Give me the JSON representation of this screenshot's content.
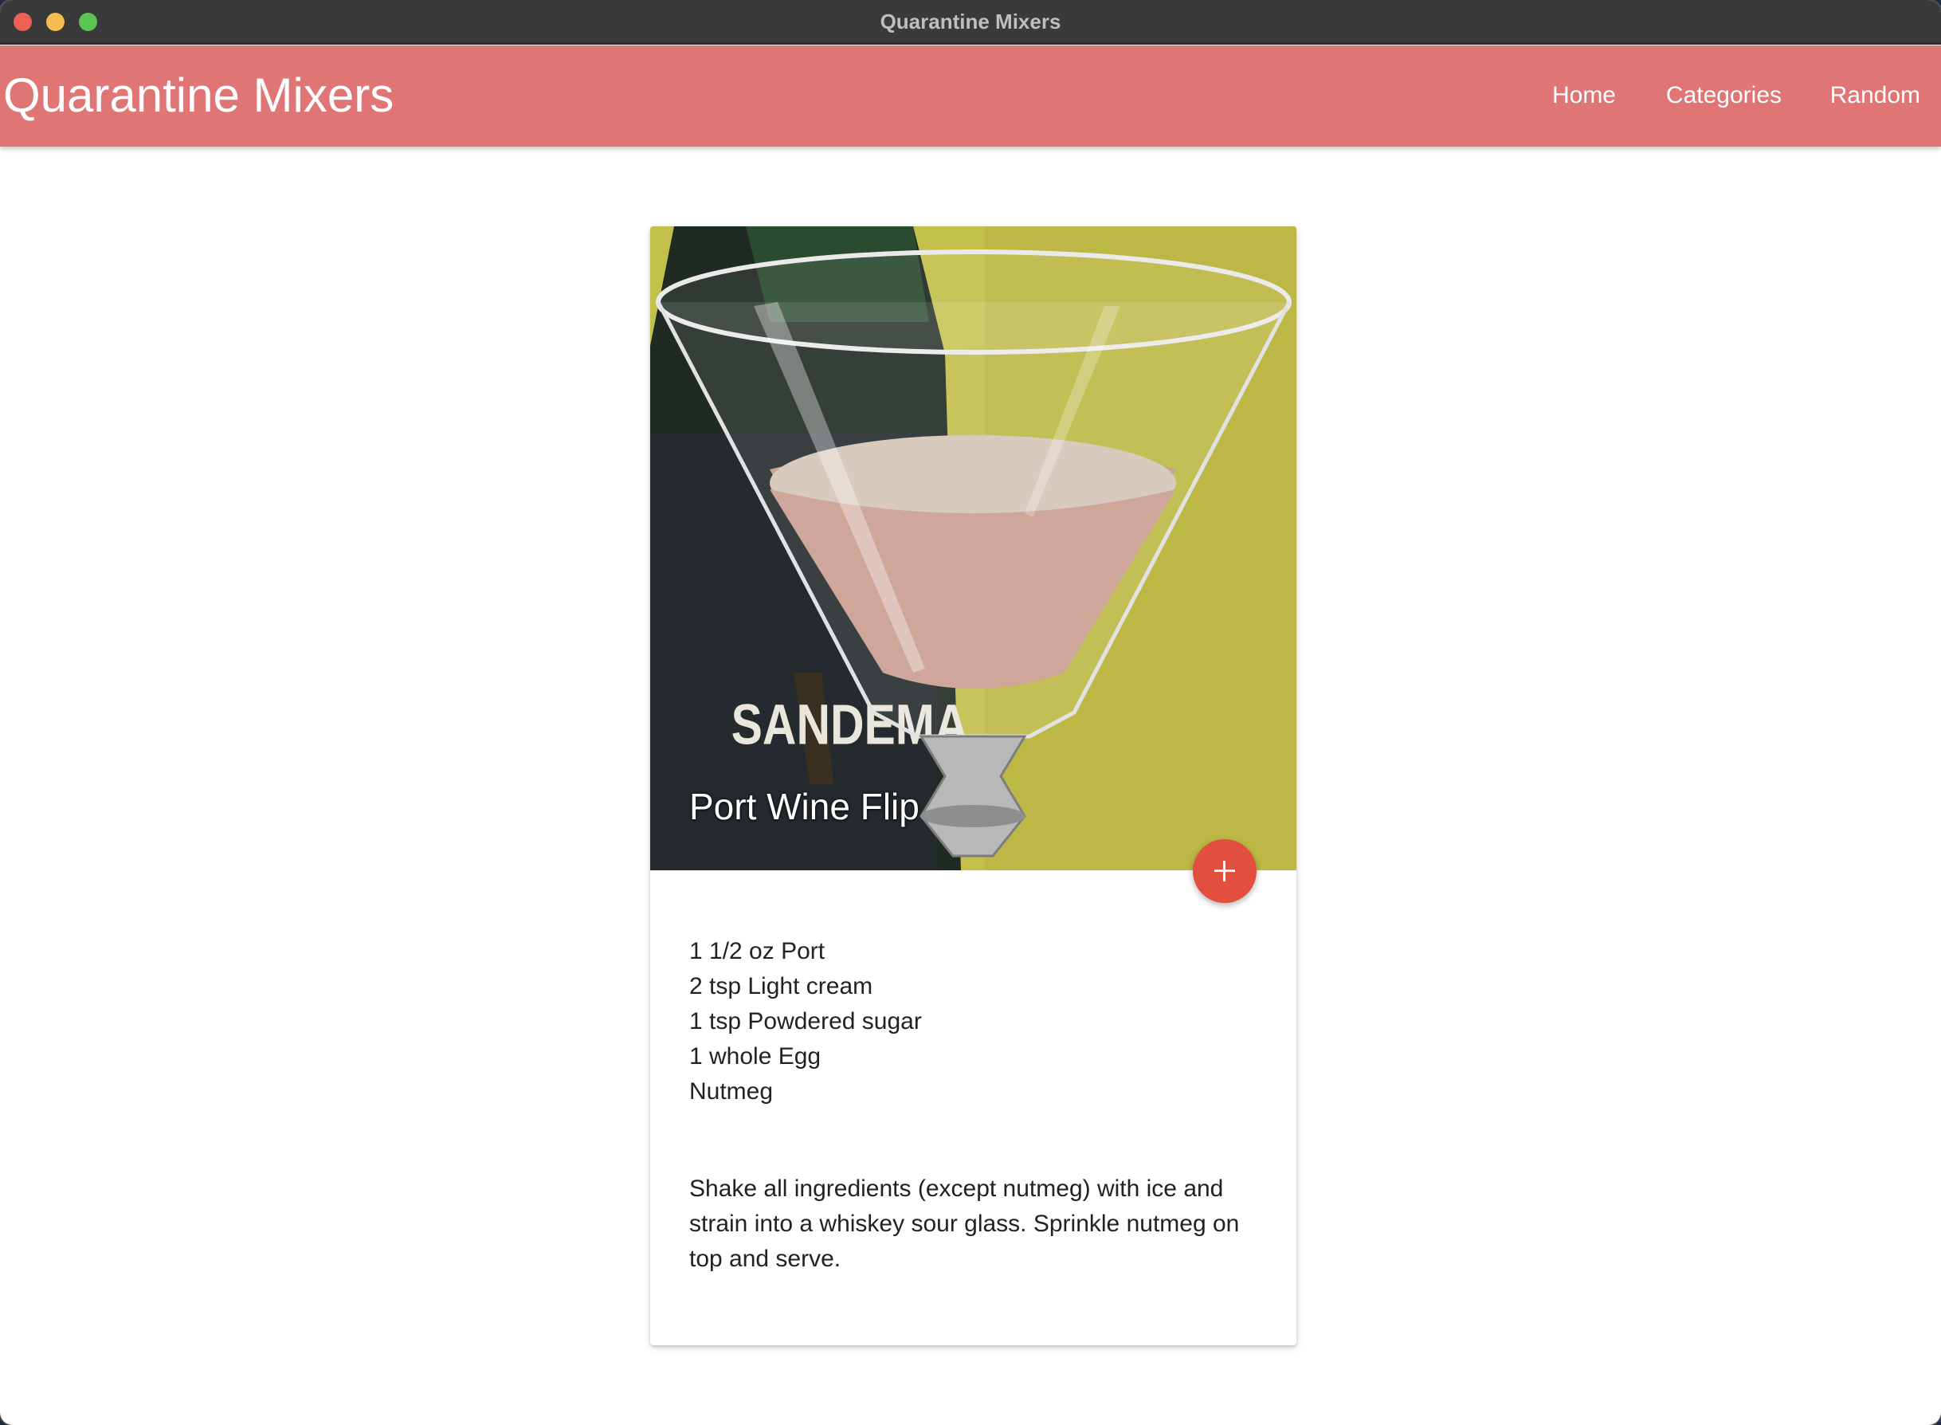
{
  "window": {
    "title": "Quarantine Mixers"
  },
  "navbar": {
    "brand": "Quarantine Mixers",
    "links": [
      {
        "label": "Home"
      },
      {
        "label": "Categories"
      },
      {
        "label": "Random"
      }
    ]
  },
  "drink": {
    "name": "Port Wine Flip",
    "image_alt": "Port Wine Flip in a cocktail glass",
    "bottle_label": "SANDEMA",
    "ingredients": [
      "1 1/2 oz Port",
      "2 tsp Light cream",
      "1 tsp Powdered sugar",
      "1 whole Egg",
      "Nutmeg"
    ],
    "instructions": "Shake all ingredients (except nutmeg) with ice and strain into a whiskey sour glass. Sprinkle nutmeg on top and serve."
  },
  "fab": {
    "icon": "plus-icon"
  },
  "colors": {
    "navbar": "#e07576",
    "fab": "#e24f3f",
    "titlebar": "#3a3a3a"
  }
}
